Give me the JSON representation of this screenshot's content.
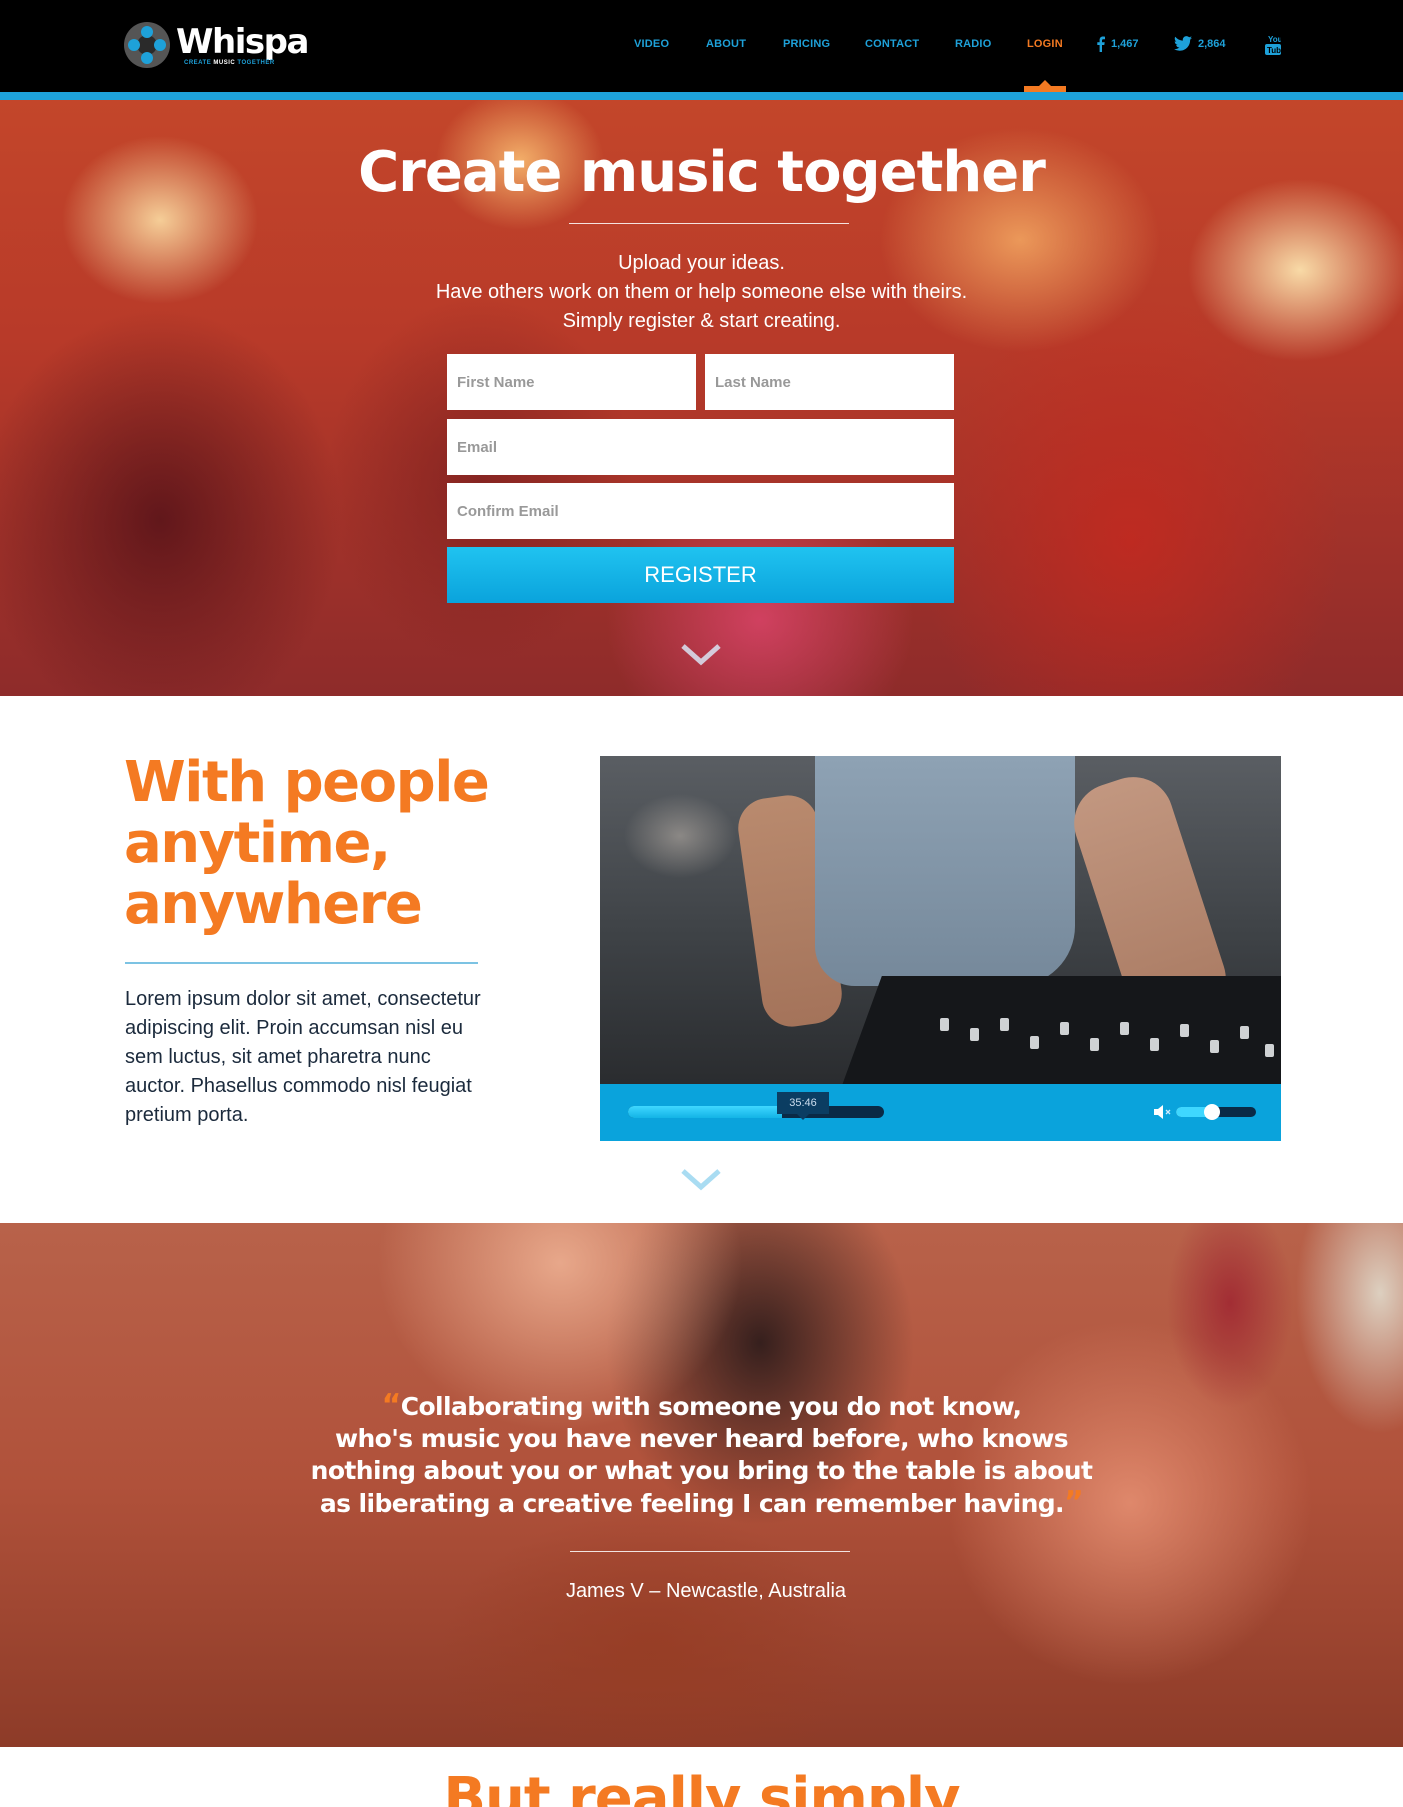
{
  "brand": {
    "name": "Whispa",
    "tagline_1": "CREATE",
    "tagline_2": "MUSIC",
    "tagline_3": "TOGETHER",
    "accent_color": "#1ea1d9",
    "highlight_color": "#f47a22"
  },
  "nav": {
    "items": [
      {
        "label": "VIDEO"
      },
      {
        "label": "ABOUT"
      },
      {
        "label": "PRICING"
      },
      {
        "label": "CONTACT"
      },
      {
        "label": "RADIO"
      },
      {
        "label": "LOGIN",
        "active": true
      }
    ],
    "facebook_count": "1,467",
    "twitter_count": "2,864",
    "icons": [
      "facebook-icon",
      "twitter-icon",
      "youtube-icon"
    ]
  },
  "hero": {
    "title": "Create music together",
    "subtitle_lines": [
      "Upload your ideas.",
      "Have others work on them or help someone else with theirs.",
      "Simply register & start creating."
    ],
    "form": {
      "first_name_placeholder": "First Name",
      "last_name_placeholder": "Last Name",
      "email_placeholder": "Email",
      "confirm_email_placeholder": "Confirm Email",
      "register_label": "REGISTER"
    }
  },
  "features": {
    "title_lines": [
      "With people",
      "anytime,",
      "anywhere"
    ],
    "body": "Lorem ipsum dolor sit amet, consectetur adipiscing elit. Proin accumsan nisl eu sem luctus, sit amet pharetra nunc auctor. Phasellus commodo nisl feugiat pretium porta.",
    "video": {
      "time_label": "35:46",
      "progress": 0.6,
      "volume": 0.45,
      "volume_icon": "mute-icon"
    }
  },
  "testimonial": {
    "open_quote": "“",
    "close_quote": "”",
    "quote_lines": [
      "Collaborating with someone you do not know,",
      "who's music you have never heard before, who knows",
      "nothing about you or what you bring to the table is about",
      "as liberating a creative feeling I can remember having."
    ],
    "author": "James V – Newcastle, Australia"
  },
  "simple": {
    "title": "But really simply"
  }
}
